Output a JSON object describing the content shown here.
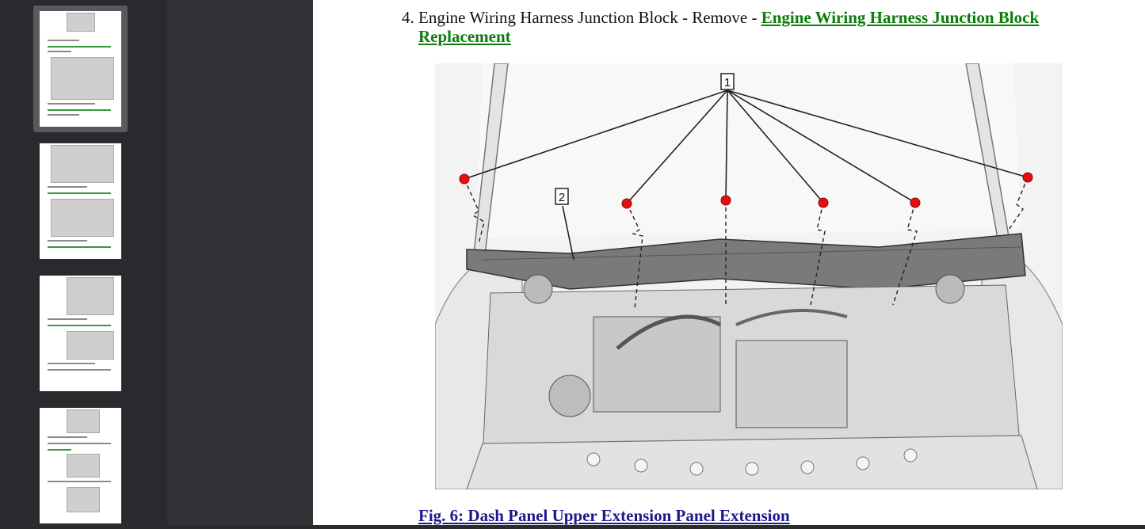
{
  "sidebar": {
    "thumbnails": [
      {
        "label": "page 1",
        "selected": true
      },
      {
        "label": "page 2",
        "selected": false
      },
      {
        "label": "page 3",
        "selected": false
      },
      {
        "label": "page 4",
        "selected": false
      }
    ]
  },
  "content": {
    "step_number": "4.",
    "step_text": "Engine Wiring Harness Junction Block - Remove - ",
    "step_link": "Engine Wiring Harness Junction Block Replacement",
    "figure": {
      "callout_1": "1",
      "callout_2": "2"
    },
    "caption": "Fig. 6: Dash Panel Upper Extension Panel Extension"
  },
  "colors": {
    "link_green": "#0a7d0a",
    "caption_blue": "#1a1a8c",
    "fastener_red": "#e01010"
  }
}
